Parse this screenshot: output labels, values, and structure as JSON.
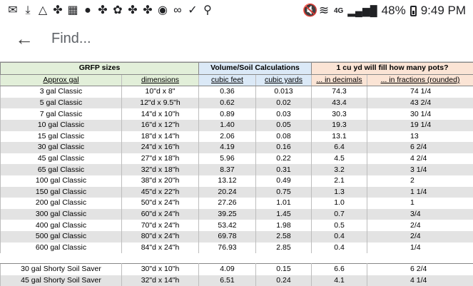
{
  "status_bar": {
    "left_icons": [
      "gmail-icon",
      "download-icon",
      "drive-icon",
      "pinwheel-icon",
      "calendar-icon",
      "circle-icon",
      "pinwheel-icon",
      "bird-icon",
      "pinwheel-icon",
      "pinwheel-icon",
      "gamepad-icon",
      "voicemail-icon",
      "check-icon",
      "keyhole-icon"
    ],
    "mute_icon": "mute-icon",
    "wifi_icon": "wifi-icon",
    "network_label": "4G",
    "battery_text": "48%",
    "time": "9:49 PM"
  },
  "find_bar": {
    "back_icon": "back-arrow-icon",
    "placeholder": "Find..."
  },
  "table": {
    "group_headers": {
      "grfp": "GRFP sizes",
      "volume": "Volume/Soil Calculations",
      "fill": "1 cu yd will fill how many pots?"
    },
    "sub_headers": [
      "Approx gal",
      "dimensions",
      "cubic feet",
      "cubic yards",
      "... in decimals",
      "... in fractions (rounded)"
    ],
    "rows": [
      [
        "3 gal Classic",
        "10\"d x 8\"",
        "0.36",
        "0.013",
        "74.3",
        "74 1/4"
      ],
      [
        "5 gal Classic",
        "12\"d x 9.5\"h",
        "0.62",
        "0.02",
        "43.4",
        "43 2/4"
      ],
      [
        "7 gal Classic",
        "14\"d x 10\"h",
        "0.89",
        "0.03",
        "30.3",
        "30 1/4"
      ],
      [
        "10 gal Classic",
        "16\"d x 12\"h",
        "1.40",
        "0.05",
        "19.3",
        "19 1/4"
      ],
      [
        "15 gal Classic",
        "18\"d x 14\"h",
        "2.06",
        "0.08",
        "13.1",
        "13"
      ],
      [
        "30 gal Classic",
        "24\"d x 16\"h",
        "4.19",
        "0.16",
        "6.4",
        "6 2/4"
      ],
      [
        "45 gal Classic",
        "27\"d x 18\"h",
        "5.96",
        "0.22",
        "4.5",
        "4 2/4"
      ],
      [
        "65 gal Classic",
        "32\"d x 18\"h",
        "8.37",
        "0.31",
        "3.2",
        "3 1/4"
      ],
      [
        "100 gal Classic",
        "38\"d x 20\"h",
        "13.12",
        "0.49",
        "2.1",
        "2"
      ],
      [
        "150 gal Classic",
        "45\"d x 22\"h",
        "20.24",
        "0.75",
        "1.3",
        "1 1/4"
      ],
      [
        "200 gal Classic",
        "50\"d x 24\"h",
        "27.26",
        "1.01",
        "1.0",
        "1"
      ],
      [
        "300 gal Classic",
        "60\"d x 24\"h",
        "39.25",
        "1.45",
        "0.7",
        "3/4"
      ],
      [
        "400 gal Classic",
        "70\"d x 24\"h",
        "53.42",
        "1.98",
        "0.5",
        "2/4"
      ],
      [
        "500 gal Classic",
        "80\"d x 24\"h",
        "69.78",
        "2.58",
        "0.4",
        "2/4"
      ],
      [
        "600 gal Classic",
        "84\"d x 24\"h",
        "76.93",
        "2.85",
        "0.4",
        "1/4"
      ]
    ],
    "rows2": [
      [
        "30 gal Shorty Soil Saver",
        "30\"d x 10\"h",
        "4.09",
        "0.15",
        "6.6",
        "6 2/4"
      ],
      [
        "45 gal Shorty Soil Saver",
        "32\"d x 14\"h",
        "6.51",
        "0.24",
        "4.1",
        "4 1/4"
      ]
    ]
  },
  "colors": {
    "grfp_header": "#e2efd9",
    "volume_header": "#dbe9f7",
    "fill_header": "#fbe4d5",
    "row_shade": "#e3e3e3"
  }
}
